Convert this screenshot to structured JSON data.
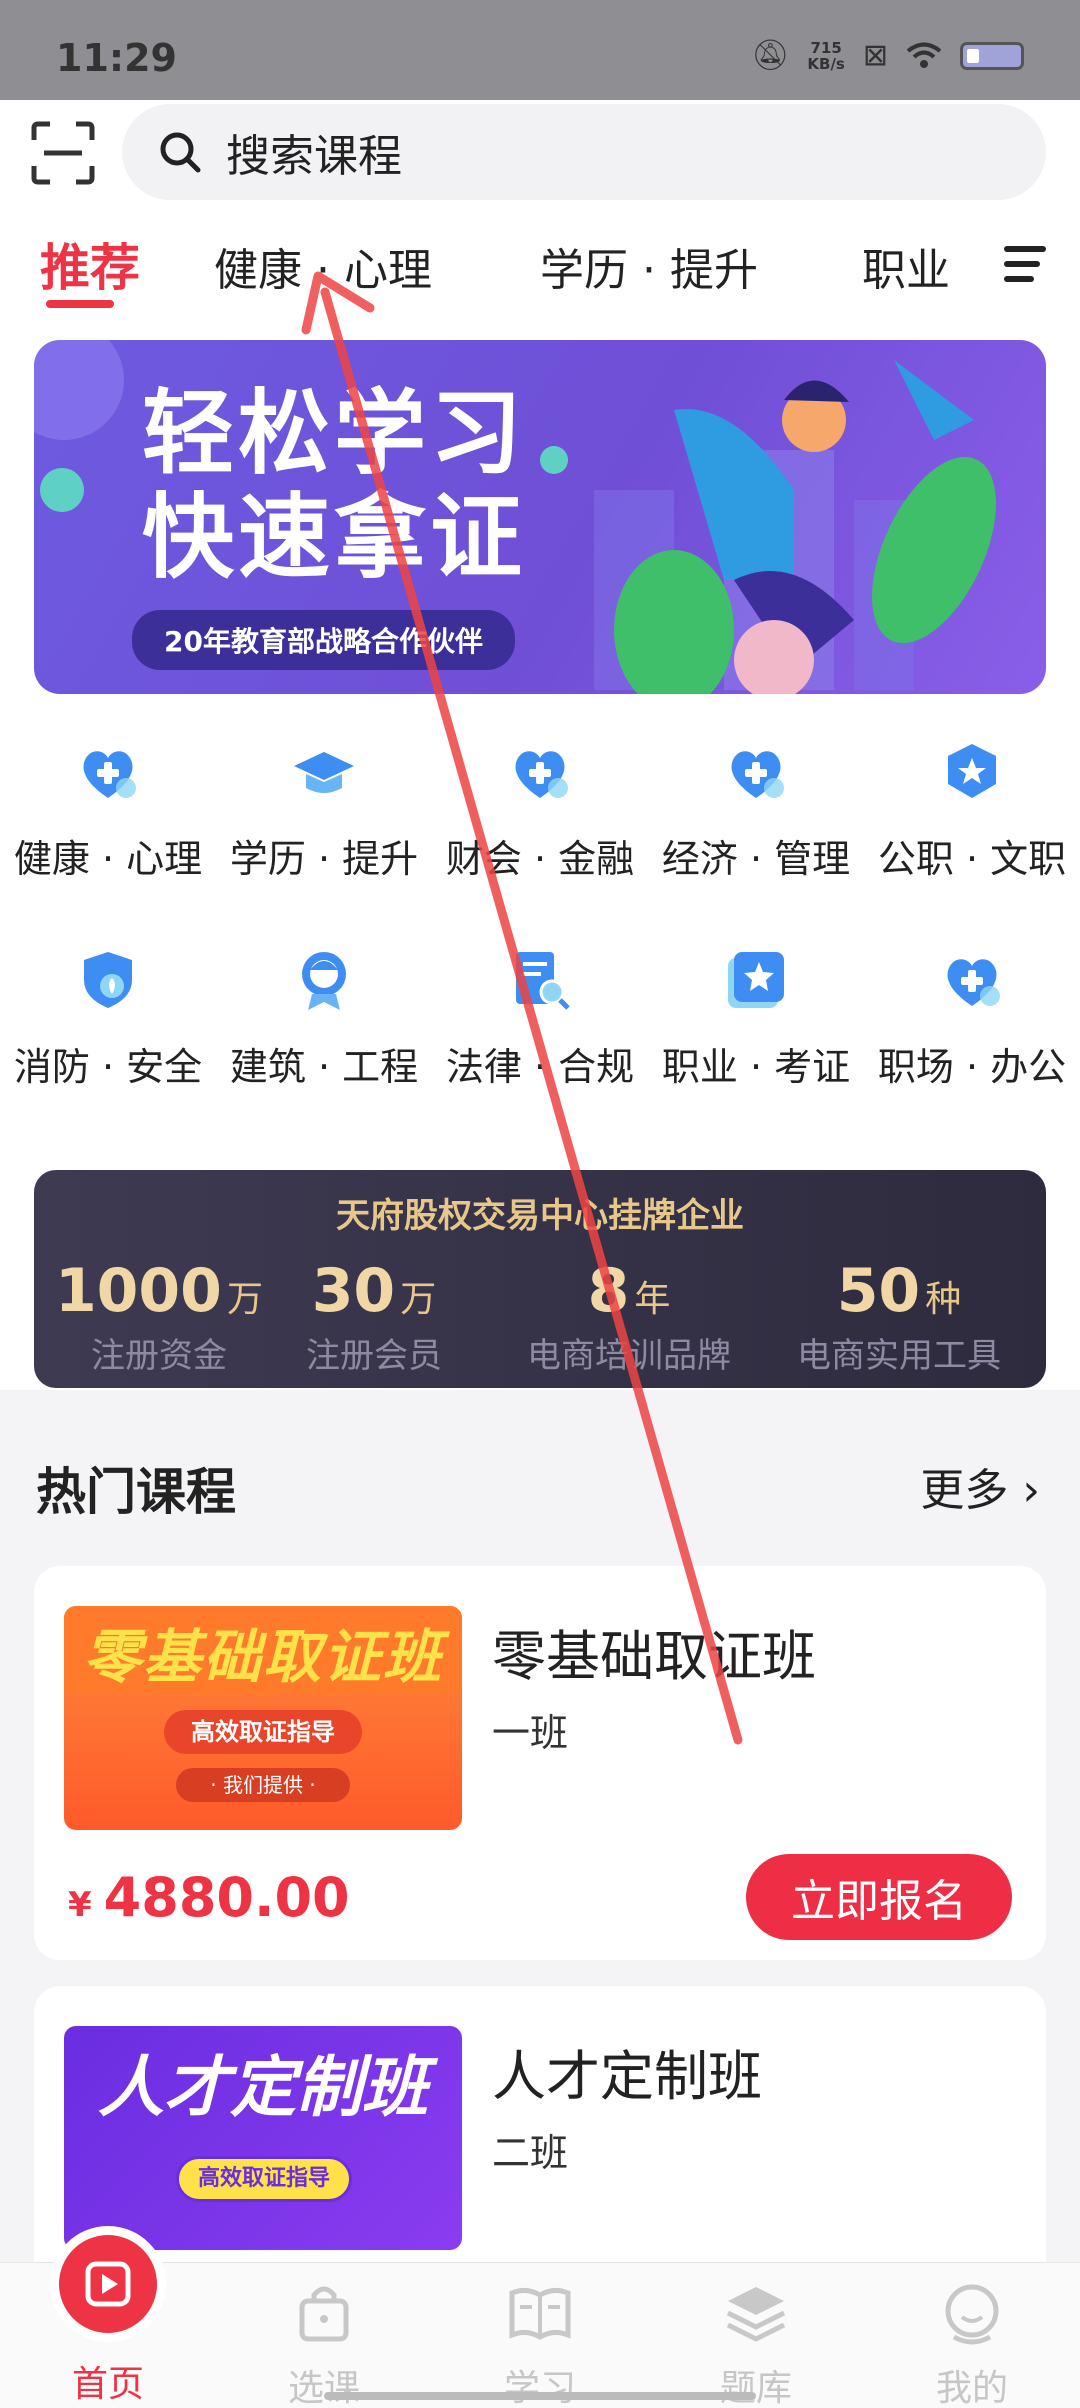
{
  "status_bar": {
    "time": "11:29",
    "net_speed": "715",
    "net_unit": "KB/s"
  },
  "search": {
    "placeholder": "搜索课程"
  },
  "tabs": [
    {
      "label": "推荐"
    },
    {
      "label": "健康 · 心理"
    },
    {
      "label": "学历 · 提升"
    },
    {
      "label": "职业"
    }
  ],
  "banner": {
    "line1": "轻松学习",
    "line2": "快速拿证",
    "tag": "20年教育部战略合作伙伴"
  },
  "categories": [
    {
      "label": "健康 · 心理",
      "icon": "heart-plus-icon"
    },
    {
      "label": "学历 · 提升",
      "icon": "graduation-cap-icon"
    },
    {
      "label": "财会 · 金融",
      "icon": "heart-plus-icon"
    },
    {
      "label": "经济 · 管理",
      "icon": "heart-plus-icon"
    },
    {
      "label": "公职 · 文职",
      "icon": "badge-star-icon"
    },
    {
      "label": "消防 · 安全",
      "icon": "shield-icon"
    },
    {
      "label": "建筑 · 工程",
      "icon": "worker-badge-icon"
    },
    {
      "label": "法律 · 合规",
      "icon": "document-search-icon"
    },
    {
      "label": "职业 · 考证",
      "icon": "star-card-icon"
    },
    {
      "label": "职场 · 办公",
      "icon": "heart-plus-icon"
    }
  ],
  "stats": {
    "title": "天府股权交易中心挂牌企业",
    "items": [
      {
        "value": "1000",
        "unit": "万",
        "label": "注册资金"
      },
      {
        "value": "30",
        "unit": "万",
        "label": "注册会员"
      },
      {
        "value": "8",
        "unit": "年",
        "label": "电商培训品牌"
      },
      {
        "value": "50",
        "unit": "种",
        "label": "电商实用工具"
      }
    ]
  },
  "hot": {
    "title": "热门课程",
    "more": "更多"
  },
  "courses": [
    {
      "name": "零基础取证班",
      "sub": "一班",
      "price": "4880.00",
      "currency": "¥",
      "button": "立即报名",
      "thumb_title": "零基础取证班",
      "thumb_tag": "高效取证指导",
      "thumb_sub": "· 我们提供 ·"
    },
    {
      "name": "人才定制班",
      "sub": "二班",
      "thumb_title": "人才定制班",
      "thumb_tag": "高效取证指导"
    }
  ],
  "bottom_nav": [
    {
      "label": "首页",
      "icon": "play-icon",
      "active": true
    },
    {
      "label": "选课",
      "icon": "bag-icon"
    },
    {
      "label": "学习",
      "icon": "book-icon"
    },
    {
      "label": "题库",
      "icon": "layers-icon"
    },
    {
      "label": "我的",
      "icon": "face-icon"
    }
  ],
  "colors": {
    "accent": "#ee3344",
    "banner": "#6d5be0",
    "stats_bg": "#2e2b3e",
    "gold": "#e8c88a"
  }
}
